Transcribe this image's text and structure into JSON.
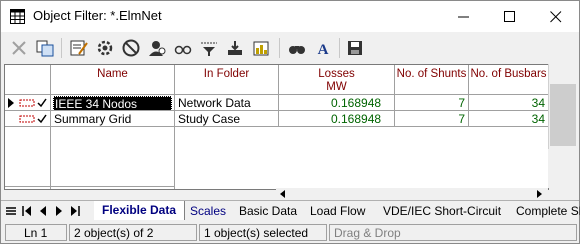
{
  "window": {
    "title": "Object Filter: *.ElmNet",
    "minimize_label": "—",
    "maximize_label": "☐",
    "close_label": "✕"
  },
  "toolbar": {
    "icons": [
      "delete-icon",
      "copy-icon",
      "edit-icon",
      "settings-icon",
      "no-icon",
      "user-icon",
      "view-icon",
      "filter-icon",
      "ruler-icon",
      "chart-icon",
      "find-icon",
      "text-icon",
      "save-icon"
    ]
  },
  "table": {
    "columns": [
      {
        "label": "Name",
        "sub": ""
      },
      {
        "label": "In Folder",
        "sub": ""
      },
      {
        "label": "Losses",
        "sub": "MW"
      },
      {
        "label": "No. of Shunts",
        "sub": ""
      },
      {
        "label": "No. of Busbars",
        "sub": ""
      }
    ],
    "rows": [
      {
        "name": "IEEE 34 Nodos",
        "folder": "Network Data",
        "losses": "0.168948",
        "shunts": "7",
        "busbars": "34",
        "selected": true
      },
      {
        "name": "Summary Grid",
        "folder": "Study Case",
        "losses": "0.168948",
        "shunts": "7",
        "busbars": "34",
        "selected": false
      }
    ]
  },
  "tabs": [
    "Flexible Data",
    "Scales",
    "Basic Data",
    "Load Flow",
    "VDE/IEC Short-Circuit",
    "Complete Sh"
  ],
  "status": {
    "line": "Ln 1",
    "count": "2 object(s) of 2",
    "selected": "1 object(s) selected",
    "mode": "Drag & Drop"
  },
  "colors": {
    "header_text": "#800000",
    "number_text": "#006400",
    "selection_bg": "#000000"
  }
}
